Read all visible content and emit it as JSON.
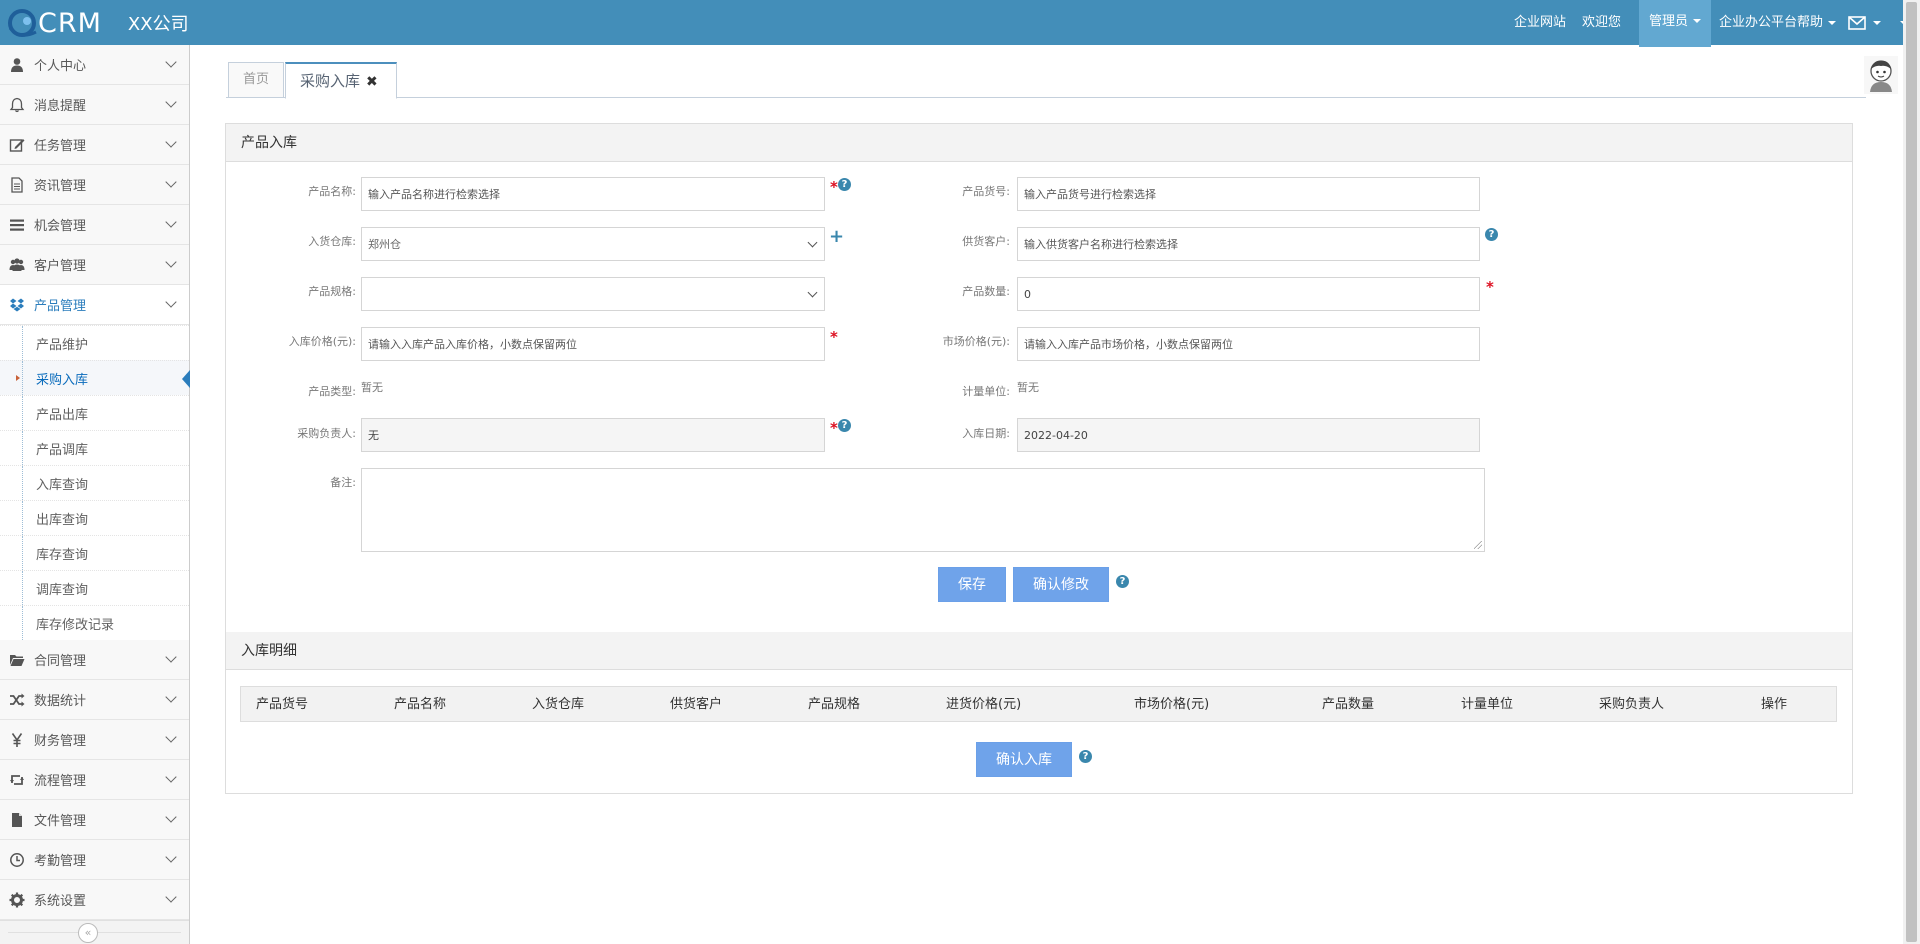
{
  "brand": {
    "logo_text": "CRM",
    "company": "XX公司"
  },
  "nav": {
    "links": [
      "企业网站",
      "欢迎您"
    ],
    "admin": "管理员",
    "help": "企业办公平台帮助"
  },
  "sidebar": {
    "items": [
      {
        "label": "个人中心",
        "icon": "user-icon"
      },
      {
        "label": "消息提醒",
        "icon": "bell-icon"
      },
      {
        "label": "任务管理",
        "icon": "edit-icon"
      },
      {
        "label": "资讯管理",
        "icon": "document-icon"
      },
      {
        "label": "机会管理",
        "icon": "list-icon"
      },
      {
        "label": "客户管理",
        "icon": "users-icon"
      },
      {
        "label": "产品管理",
        "icon": "dropbox-icon"
      }
    ],
    "sub_items": [
      "产品维护",
      "采购入库",
      "产品出库",
      "产品调库",
      "入库查询",
      "出库查询",
      "库存查询",
      "调库查询",
      "库存修改记录"
    ],
    "items_after": [
      {
        "label": "合同管理",
        "icon": "folder-icon"
      },
      {
        "label": "数据统计",
        "icon": "shuffle-icon"
      },
      {
        "label": "财务管理",
        "icon": "yen-icon"
      },
      {
        "label": "流程管理",
        "icon": "retweet-icon"
      },
      {
        "label": "文件管理",
        "icon": "file-icon"
      },
      {
        "label": "考勤管理",
        "icon": "clock-icon"
      },
      {
        "label": "系统设置",
        "icon": "gear-icon"
      }
    ],
    "collapse_glyph": "«"
  },
  "tabs": {
    "home": "首页",
    "active": "采购入库",
    "close_glyph": "✖"
  },
  "form": {
    "title": "产品入库",
    "product_name": {
      "label": "产品名称:",
      "placeholder": "输入产品名称进行检索选择"
    },
    "product_code": {
      "label": "产品货号:",
      "placeholder": "输入产品货号进行检索选择"
    },
    "warehouse": {
      "label": "入货仓库:",
      "value": "郑州仓"
    },
    "supplier": {
      "label": "供货客户:",
      "placeholder": "输入供货客户名称进行检索选择"
    },
    "spec": {
      "label": "产品规格:",
      "value": ""
    },
    "quantity": {
      "label": "产品数量:",
      "value": "0"
    },
    "in_price": {
      "label": "入库价格(元):",
      "placeholder": "请输入入库产品入库价格，小数点保留两位"
    },
    "market_price": {
      "label": "市场价格(元):",
      "placeholder": "请输入入库产品市场价格，小数点保留两位"
    },
    "product_type": {
      "label": "产品类型:",
      "value": "暂无"
    },
    "unit": {
      "label": "计量单位:",
      "value": "暂无"
    },
    "buyer": {
      "label": "采购负责人:",
      "value": "无"
    },
    "in_date": {
      "label": "入库日期:",
      "value": "2022-04-20"
    },
    "remark": {
      "label": "备注:"
    },
    "save_btn": "保存",
    "confirm_edit_btn": "确认修改",
    "required_mark": "*",
    "help_mark": "?",
    "plus_mark": "+"
  },
  "detail": {
    "title": "入库明细",
    "columns": [
      "产品货号",
      "产品名称",
      "入货仓库",
      "供货客户",
      "产品规格",
      "进货价格(元)",
      "市场价格(元)",
      "产品数量",
      "计量单位",
      "采购负责人",
      "操作"
    ],
    "confirm_btn": "确认入库"
  },
  "colors": {
    "navbar": "#438eb9",
    "accent": "#2b7dbc",
    "button": "#6fa3ea"
  }
}
